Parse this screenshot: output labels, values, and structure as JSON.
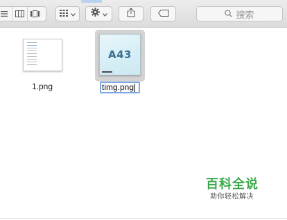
{
  "toolbar": {
    "search_placeholder": "搜索",
    "icons": [
      "list-view-icon",
      "column-view-icon",
      "gallery-view-icon",
      "icon-grid-icon",
      "gear-icon",
      "share-icon",
      "tag-icon",
      "search-icon"
    ]
  },
  "files": [
    {
      "name": "1.png",
      "selected": false
    },
    {
      "name": "timg.png",
      "selected": true,
      "renaming": true,
      "thumbnail_text": "A43"
    }
  ],
  "watermark": {
    "title": "百科全说",
    "subtitle": "助你轻松解决",
    "color": "#3aa84a"
  }
}
